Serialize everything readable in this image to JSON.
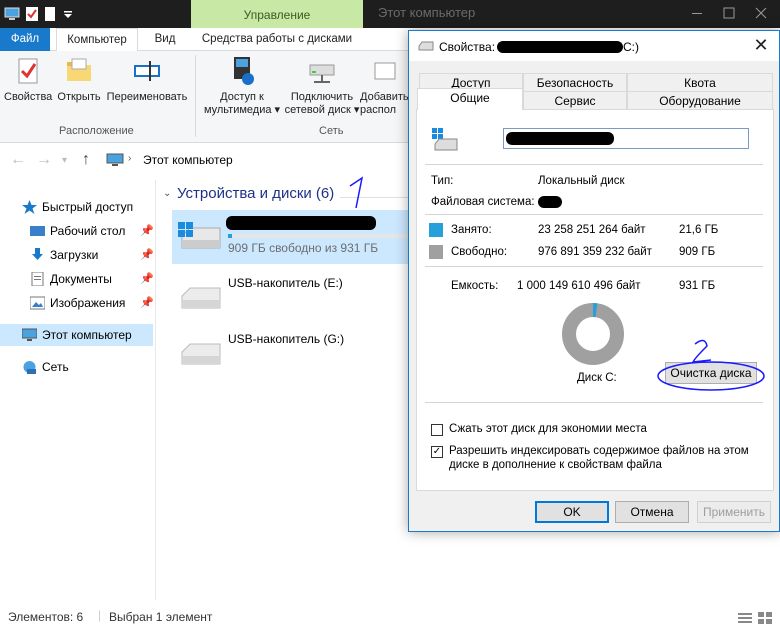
{
  "explorer": {
    "window_title": "Этот компьютер",
    "context_tab": "Управление",
    "tabs": [
      "Файл",
      "Компьютер",
      "Вид",
      "Средства работы с дисками"
    ],
    "ribbon": {
      "buttons": [
        "Свойства",
        "Открыть",
        "Переименовать",
        "Доступ к мультимедиа ▾",
        "Подключить сетевой диск ▾",
        "Добавить распол..."
      ],
      "button_lines": {
        "media_1": "Доступ к",
        "media_2": "мультимедиа ▾",
        "netdisk_1": "Подключить",
        "netdisk_2": "сетевой диск ▾",
        "add_1": "Добавить",
        "add_2": "распол"
      },
      "groups": [
        "Расположение",
        "Сеть"
      ]
    },
    "address": "Этот компьютер",
    "nav": {
      "quick_access": "Быстрый доступ",
      "desktop": "Рабочий стол",
      "downloads": "Загрузки",
      "documents": "Документы",
      "pictures": "Изображения",
      "this_pc": "Этот компьютер",
      "network": "Сеть"
    },
    "section_title": "Устройства и диски (6)",
    "drives": [
      {
        "name": "",
        "free_text": "909 ГБ свободно из 931 ГБ",
        "used_fraction": 0.023
      },
      {
        "name": "USB-накопитель (E:)"
      },
      {
        "name": "USB-накопитель (G:)"
      }
    ],
    "status": {
      "items": "Элементов: 6",
      "selected": "Выбран 1 элемент"
    }
  },
  "dialog": {
    "title": "Свойства:",
    "title_suffix": "C:)",
    "tabs_row1": [
      "Доступ",
      "Безопасность",
      "Квота"
    ],
    "tabs_row2": [
      "Общие",
      "Сервис",
      "Оборудование"
    ],
    "type_label": "Тип:",
    "type_value": "Локальный диск",
    "fs_label": "Файловая система:",
    "used_label": "Занято:",
    "used_bytes": "23 258 251 264 байт",
    "used_gb": "21,6 ГБ",
    "free_label": "Свободно:",
    "free_bytes": "976 891 359 232 байт",
    "free_gb": "909 ГБ",
    "cap_label": "Емкость:",
    "cap_bytes": "1 000 149 610 496 байт",
    "cap_gb": "931 ГБ",
    "disk_label": "Диск C:",
    "used_fraction": 0.023,
    "cleanup_button": "Очистка диска",
    "compress_label": "Сжать этот диск для экономии места",
    "compress_checked": false,
    "index_label_1": "Разрешить индексировать содержимое файлов на этом",
    "index_label_2": "диске в дополнение к свойствам файла",
    "index_checked": true,
    "ok": "OK",
    "cancel": "Отмена",
    "apply": "Применить"
  },
  "annotations": {
    "mark1": "1",
    "mark2": "2"
  },
  "colors": {
    "used": "#26a0da",
    "free": "#a0a0a0",
    "accent": "#1979ca",
    "annotation": "#1a1aff"
  }
}
